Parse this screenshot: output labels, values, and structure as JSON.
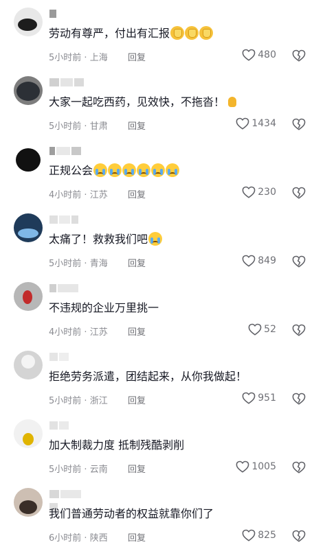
{
  "comments": [
    {
      "text": "劳动有尊严，付出有汇报",
      "emoji": "clap",
      "emoji_count": 3,
      "time": "5小时前",
      "location": "上海",
      "reply": "回复",
      "likes": "480"
    },
    {
      "text": "大家一起吃西药，见效快，不拖沓！",
      "emoji": "fist",
      "emoji_count": 1,
      "time": "5小时前",
      "location": "甘肃",
      "reply": "回复",
      "likes": "1434"
    },
    {
      "text": "正规公会",
      "emoji": "cry",
      "emoji_count": 6,
      "time": "4小时前",
      "location": "江苏",
      "reply": "回复",
      "likes": "230"
    },
    {
      "text": "太痛了！救救我们吧",
      "emoji": "cry",
      "emoji_count": 1,
      "time": "5小时前",
      "location": "青海",
      "reply": "回复",
      "likes": "849"
    },
    {
      "text": "不违规的企业万里挑一",
      "emoji": "",
      "emoji_count": 0,
      "time": "4小时前",
      "location": "江苏",
      "reply": "回复",
      "likes": "52"
    },
    {
      "text": "拒绝劳务派遣，团结起来，从你我做起！",
      "emoji": "",
      "emoji_count": 0,
      "time": "5小时前",
      "location": "浙江",
      "reply": "回复",
      "likes": "951"
    },
    {
      "text": "加大制裁力度    抵制残酷剥削",
      "emoji": "",
      "emoji_count": 0,
      "time": "5小时前",
      "location": "云南",
      "reply": "回复",
      "likes": "1005"
    },
    {
      "text": "我们普通劳动者的权益就靠你们了",
      "emoji": "",
      "emoji_count": 0,
      "time": "6小时前",
      "location": "陕西",
      "reply": "回复",
      "likes": "825"
    }
  ],
  "icons": {
    "like": "heart-outline-icon",
    "dislike": "broken-heart-icon"
  },
  "colors": {
    "text": "#161823",
    "meta": "#8a8b91",
    "icon": "#5f6066"
  }
}
